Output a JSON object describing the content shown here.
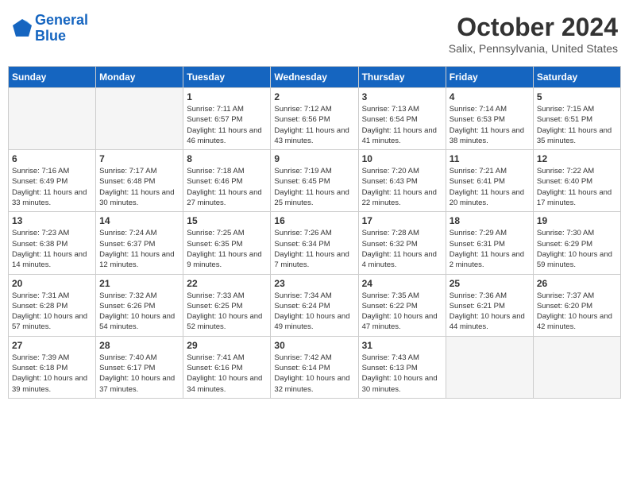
{
  "header": {
    "logo_line1": "General",
    "logo_line2": "Blue",
    "month_year": "October 2024",
    "location": "Salix, Pennsylvania, United States"
  },
  "weekdays": [
    "Sunday",
    "Monday",
    "Tuesday",
    "Wednesday",
    "Thursday",
    "Friday",
    "Saturday"
  ],
  "weeks": [
    [
      {
        "day": "",
        "info": ""
      },
      {
        "day": "",
        "info": ""
      },
      {
        "day": "1",
        "info": "Sunrise: 7:11 AM\nSunset: 6:57 PM\nDaylight: 11 hours and 46 minutes."
      },
      {
        "day": "2",
        "info": "Sunrise: 7:12 AM\nSunset: 6:56 PM\nDaylight: 11 hours and 43 minutes."
      },
      {
        "day": "3",
        "info": "Sunrise: 7:13 AM\nSunset: 6:54 PM\nDaylight: 11 hours and 41 minutes."
      },
      {
        "day": "4",
        "info": "Sunrise: 7:14 AM\nSunset: 6:53 PM\nDaylight: 11 hours and 38 minutes."
      },
      {
        "day": "5",
        "info": "Sunrise: 7:15 AM\nSunset: 6:51 PM\nDaylight: 11 hours and 35 minutes."
      }
    ],
    [
      {
        "day": "6",
        "info": "Sunrise: 7:16 AM\nSunset: 6:49 PM\nDaylight: 11 hours and 33 minutes."
      },
      {
        "day": "7",
        "info": "Sunrise: 7:17 AM\nSunset: 6:48 PM\nDaylight: 11 hours and 30 minutes."
      },
      {
        "day": "8",
        "info": "Sunrise: 7:18 AM\nSunset: 6:46 PM\nDaylight: 11 hours and 27 minutes."
      },
      {
        "day": "9",
        "info": "Sunrise: 7:19 AM\nSunset: 6:45 PM\nDaylight: 11 hours and 25 minutes."
      },
      {
        "day": "10",
        "info": "Sunrise: 7:20 AM\nSunset: 6:43 PM\nDaylight: 11 hours and 22 minutes."
      },
      {
        "day": "11",
        "info": "Sunrise: 7:21 AM\nSunset: 6:41 PM\nDaylight: 11 hours and 20 minutes."
      },
      {
        "day": "12",
        "info": "Sunrise: 7:22 AM\nSunset: 6:40 PM\nDaylight: 11 hours and 17 minutes."
      }
    ],
    [
      {
        "day": "13",
        "info": "Sunrise: 7:23 AM\nSunset: 6:38 PM\nDaylight: 11 hours and 14 minutes."
      },
      {
        "day": "14",
        "info": "Sunrise: 7:24 AM\nSunset: 6:37 PM\nDaylight: 11 hours and 12 minutes."
      },
      {
        "day": "15",
        "info": "Sunrise: 7:25 AM\nSunset: 6:35 PM\nDaylight: 11 hours and 9 minutes."
      },
      {
        "day": "16",
        "info": "Sunrise: 7:26 AM\nSunset: 6:34 PM\nDaylight: 11 hours and 7 minutes."
      },
      {
        "day": "17",
        "info": "Sunrise: 7:28 AM\nSunset: 6:32 PM\nDaylight: 11 hours and 4 minutes."
      },
      {
        "day": "18",
        "info": "Sunrise: 7:29 AM\nSunset: 6:31 PM\nDaylight: 11 hours and 2 minutes."
      },
      {
        "day": "19",
        "info": "Sunrise: 7:30 AM\nSunset: 6:29 PM\nDaylight: 10 hours and 59 minutes."
      }
    ],
    [
      {
        "day": "20",
        "info": "Sunrise: 7:31 AM\nSunset: 6:28 PM\nDaylight: 10 hours and 57 minutes."
      },
      {
        "day": "21",
        "info": "Sunrise: 7:32 AM\nSunset: 6:26 PM\nDaylight: 10 hours and 54 minutes."
      },
      {
        "day": "22",
        "info": "Sunrise: 7:33 AM\nSunset: 6:25 PM\nDaylight: 10 hours and 52 minutes."
      },
      {
        "day": "23",
        "info": "Sunrise: 7:34 AM\nSunset: 6:24 PM\nDaylight: 10 hours and 49 minutes."
      },
      {
        "day": "24",
        "info": "Sunrise: 7:35 AM\nSunset: 6:22 PM\nDaylight: 10 hours and 47 minutes."
      },
      {
        "day": "25",
        "info": "Sunrise: 7:36 AM\nSunset: 6:21 PM\nDaylight: 10 hours and 44 minutes."
      },
      {
        "day": "26",
        "info": "Sunrise: 7:37 AM\nSunset: 6:20 PM\nDaylight: 10 hours and 42 minutes."
      }
    ],
    [
      {
        "day": "27",
        "info": "Sunrise: 7:39 AM\nSunset: 6:18 PM\nDaylight: 10 hours and 39 minutes."
      },
      {
        "day": "28",
        "info": "Sunrise: 7:40 AM\nSunset: 6:17 PM\nDaylight: 10 hours and 37 minutes."
      },
      {
        "day": "29",
        "info": "Sunrise: 7:41 AM\nSunset: 6:16 PM\nDaylight: 10 hours and 34 minutes."
      },
      {
        "day": "30",
        "info": "Sunrise: 7:42 AM\nSunset: 6:14 PM\nDaylight: 10 hours and 32 minutes."
      },
      {
        "day": "31",
        "info": "Sunrise: 7:43 AM\nSunset: 6:13 PM\nDaylight: 10 hours and 30 minutes."
      },
      {
        "day": "",
        "info": ""
      },
      {
        "day": "",
        "info": ""
      }
    ]
  ]
}
